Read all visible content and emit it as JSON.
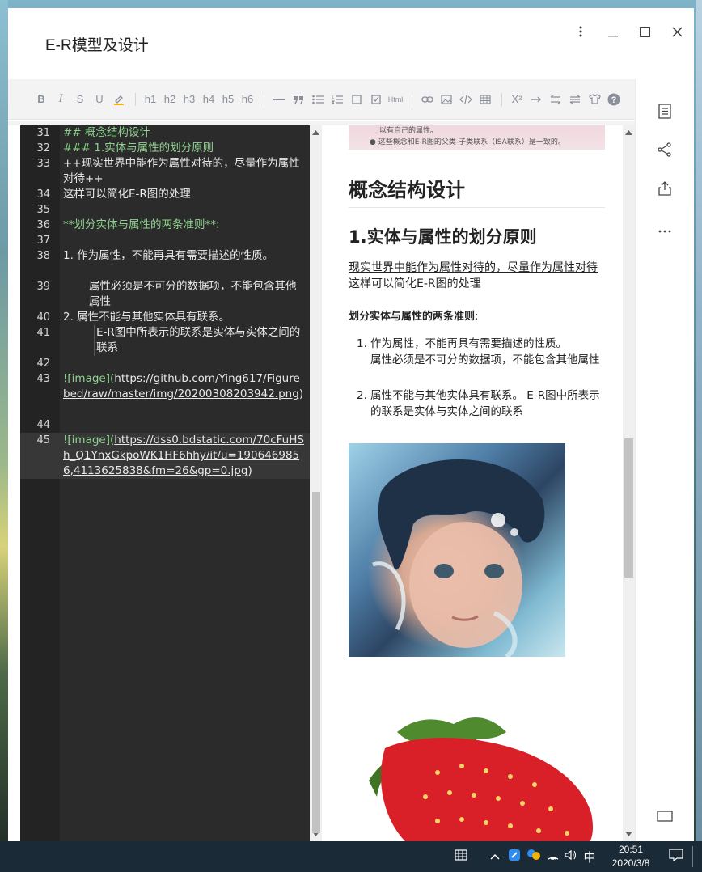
{
  "window": {
    "title": "E-R模型及设计"
  },
  "toolbar": {
    "items": [
      "B",
      "I",
      "S",
      "U",
      "highlight",
      "h1",
      "h2",
      "h3",
      "h4",
      "h5",
      "h6",
      "—",
      "quote",
      "ul",
      "ol",
      "checkbox",
      "task",
      "Html",
      "link",
      "image",
      "code",
      "table",
      "X²",
      "→",
      "⇆",
      "⇄",
      "shirt",
      "?"
    ],
    "h1": "h1",
    "h2": "h2",
    "h3": "h3",
    "h4": "h4",
    "h5": "h5",
    "h6": "h6",
    "bold": "B",
    "italic": "I",
    "strike": "S",
    "underline": "U",
    "html": "Html",
    "superscript": "X²"
  },
  "editor": {
    "lines": [
      {
        "n": "31",
        "text": "## 概念结构设计"
      },
      {
        "n": "32",
        "text": "### 1.实体与属性的划分原则"
      },
      {
        "n": "33",
        "text": "++现实世界中能作为属性对待的，尽量作为属性对待++"
      },
      {
        "n": "34",
        "text": "这样可以简化E-R图的处理"
      },
      {
        "n": "35",
        "text": ""
      },
      {
        "n": "36",
        "text": "**划分实体与属性的两条准则**:"
      },
      {
        "n": "37",
        "text": ""
      },
      {
        "n": "38",
        "text": "1.  作为属性，不能再具有需要描述的性质。"
      },
      {
        "n": "39",
        "text": "    属性必须是不可分的数据项，不能包含其他属性"
      },
      {
        "n": "40",
        "text": "2. 属性不能与其他实体具有联系。"
      },
      {
        "n": "41",
        "text": "E-R图中所表示的联系是实体与实体之间的联系"
      },
      {
        "n": "42",
        "text": ""
      },
      {
        "n": "43",
        "text_a": "![image](",
        "url": "https://github.com/Ying617/Figurebed/raw/master/img/20200308203942.png",
        "text_b": ")"
      },
      {
        "n": "44",
        "text": ""
      },
      {
        "n": "45",
        "text_a": "![image](",
        "url": "https://dss0.bdstatic.com/70cFuHSh_Q1YnxGkpoWK1HF6hhy/it/u=1906469856,4113625838&fm=26&gp=0.jpg",
        "text_b": ")"
      }
    ]
  },
  "preview": {
    "top_img_line1": "以有自己的属性。",
    "top_img_line2": "● 这些概念和E-R图的父类-子类联系（ISA联系）是一致的。",
    "h1": "概念结构设计",
    "h2": "1.实体与属性的划分原则",
    "p_underline": "现实世界中能作为属性对待的，尽量作为属性对待",
    "p_plain": "这样可以简化E-R图的处理",
    "criteria_bold": "划分实体与属性的两条准则",
    "criteria_colon": ":",
    "list": [
      {
        "num": "1.",
        "line1": "作为属性，不能再具有需要描述的性质。",
        "line2": "属性必须是不可分的数据项，不能包含其他属性"
      },
      {
        "num": "2.",
        "line1": "属性不能与其他实体具有联系。 E-R图中所表示的联系是实体与实体之间的联系"
      }
    ]
  },
  "taskbar": {
    "ime": "中",
    "time": "20:51",
    "date": "2020/3/8"
  },
  "colors": {
    "accent_heading": "#8fd28f",
    "editor_bg": "#2b2b2b",
    "taskbar_bg": "#1b2a37"
  }
}
